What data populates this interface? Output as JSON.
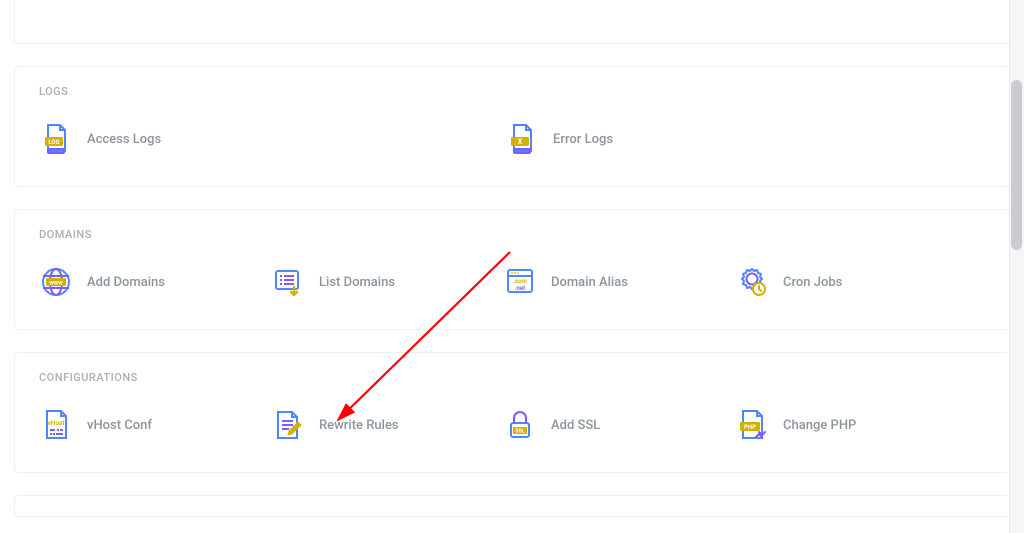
{
  "sections": {
    "logs": {
      "title": "LOGS",
      "items": {
        "access": "Access Logs",
        "error": "Error Logs"
      }
    },
    "domains": {
      "title": "DOMAINS",
      "items": {
        "add": "Add Domains",
        "list": "List Domains",
        "alias": "Domain Alias",
        "cron": "Cron Jobs"
      }
    },
    "configurations": {
      "title": "CONFIGURATIONS",
      "items": {
        "vhost": "vHost Conf",
        "rewrite": "Rewrite Rules",
        "ssl": "Add SSL",
        "php": "Change PHP"
      }
    }
  },
  "icon_text": {
    "log": "LOG",
    "x": "X",
    "www": "www",
    "com_net": ".com\n.net",
    "vhost": "vHost",
    "ssl": "SSL",
    "php": "PHP"
  }
}
